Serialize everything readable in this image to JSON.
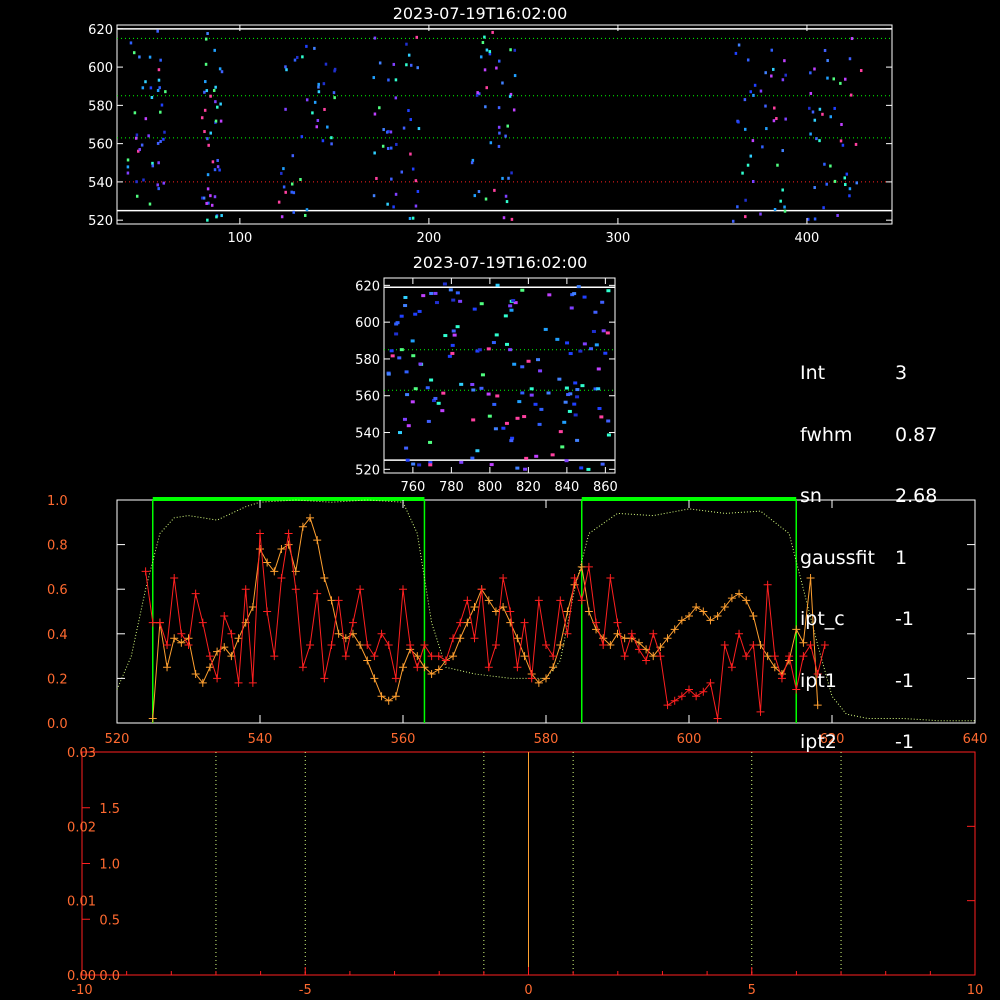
{
  "panels": {
    "top_title": "2023-07-19T16:02:00",
    "mid_title": "2023-07-19T16:02:00"
  },
  "info": [
    {
      "key": "Int",
      "value": "3"
    },
    {
      "key": "fwhm",
      "value": "0.87"
    },
    {
      "key": "sn",
      "value": "2.68"
    },
    {
      "key": "gaussfit",
      "value": "1"
    },
    {
      "key": "ipt_c",
      "value": "-1"
    },
    {
      "key": "ipt1",
      "value": "-1"
    },
    {
      "key": "ipt2",
      "value": "-1"
    }
  ],
  "colors": {
    "background": "#000000",
    "axes": "#ffffff",
    "red": "#ff2020",
    "orange": "#ffa030",
    "green": "#00ff00",
    "yellowgreen": "#d8ff80",
    "tick_orange": "#ff6a30"
  },
  "chart_data": [
    {
      "type": "heatmap",
      "name": "top-spectrogram",
      "title": "2023-07-19T16:02:00",
      "xlim": [
        35,
        445
      ],
      "ylim": [
        518,
        622
      ],
      "x_ticks": [
        100,
        200,
        300,
        400
      ],
      "y_ticks": [
        520,
        540,
        560,
        580,
        600,
        620
      ],
      "hlines": [
        {
          "y": 615,
          "style": "dotted",
          "color": "#00ff00"
        },
        {
          "y": 585,
          "style": "dotted",
          "color": "#00ff00"
        },
        {
          "y": 563,
          "style": "dotted",
          "color": "#00ff00"
        },
        {
          "y": 540,
          "style": "dotted",
          "color": "#ff2020"
        },
        {
          "y": 620,
          "style": "solid",
          "color": "#ffffff"
        },
        {
          "y": 525,
          "style": "solid",
          "color": "#ffffff"
        }
      ],
      "dot_clusters": [
        [
          40,
          60
        ],
        [
          78,
          90
        ],
        [
          120,
          150
        ],
        [
          170,
          195
        ],
        [
          222,
          245
        ],
        [
          360,
          390
        ],
        [
          400,
          430
        ]
      ]
    },
    {
      "type": "heatmap",
      "name": "middle-spectrogram",
      "title": "2023-07-19T16:02:00",
      "xlim": [
        745,
        865
      ],
      "ylim": [
        518,
        624
      ],
      "x_ticks": [
        760,
        780,
        800,
        820,
        840,
        860
      ],
      "y_ticks": [
        520,
        540,
        560,
        580,
        600,
        620
      ],
      "hlines": [
        {
          "y": 585,
          "style": "dotted",
          "color": "#00ff00"
        },
        {
          "y": 563,
          "style": "dotted",
          "color": "#00ff00"
        },
        {
          "y": 619,
          "style": "solid",
          "color": "#ffffff"
        },
        {
          "y": 525,
          "style": "solid",
          "color": "#ffffff"
        }
      ]
    },
    {
      "type": "line",
      "name": "profile-plot",
      "xlim": [
        520,
        640
      ],
      "ylim": [
        0,
        1.0
      ],
      "x_ticks": [
        520,
        540,
        560,
        580,
        600,
        620,
        640
      ],
      "y_ticks": [
        0.0,
        0.2,
        0.4,
        0.6,
        0.8,
        1.0
      ],
      "windows": [
        [
          525,
          563
        ],
        [
          585,
          615
        ]
      ],
      "series": [
        {
          "style": "dotted",
          "color": "#d8ff80",
          "x": [
            520,
            522,
            524,
            526,
            528,
            530,
            532,
            534,
            536,
            538,
            540,
            545,
            550,
            555,
            560,
            562,
            564,
            566,
            570,
            575,
            580,
            582,
            584,
            586,
            590,
            595,
            600,
            605,
            610,
            614,
            616,
            618,
            620,
            622,
            625,
            630,
            635,
            640
          ],
          "y": [
            0.15,
            0.3,
            0.6,
            0.85,
            0.92,
            0.93,
            0.92,
            0.91,
            0.94,
            0.97,
            0.99,
            1.0,
            0.99,
            1.0,
            0.99,
            0.85,
            0.45,
            0.25,
            0.22,
            0.2,
            0.2,
            0.28,
            0.6,
            0.85,
            0.94,
            0.93,
            0.96,
            0.94,
            0.95,
            0.85,
            0.6,
            0.35,
            0.12,
            0.04,
            0.02,
            0.02,
            0.01,
            0.01
          ]
        },
        {
          "style": "solid",
          "color": "#ffa030",
          "marker": "+",
          "x": [
            525,
            526,
            527,
            528,
            529,
            530,
            531,
            532,
            533,
            534,
            535,
            536,
            537,
            538,
            539,
            540,
            541,
            542,
            543,
            544,
            545,
            546,
            547,
            548,
            549,
            550,
            551,
            552,
            553,
            554,
            555,
            556,
            557,
            558,
            559,
            560,
            561,
            562,
            563,
            564,
            565,
            566,
            567,
            568,
            569,
            570,
            571,
            572,
            573,
            574,
            575,
            576,
            577,
            578,
            579,
            580,
            581,
            582,
            583,
            584,
            585,
            586,
            587,
            588,
            589,
            590,
            591,
            592,
            593,
            594,
            595,
            596,
            597,
            598,
            599,
            600,
            601,
            602,
            603,
            604,
            605,
            606,
            607,
            608,
            609,
            610,
            611,
            612,
            613,
            614,
            615,
            616,
            617,
            618
          ],
          "y": [
            0.02,
            0.45,
            0.25,
            0.38,
            0.36,
            0.38,
            0.22,
            0.18,
            0.25,
            0.32,
            0.34,
            0.3,
            0.38,
            0.45,
            0.52,
            0.78,
            0.72,
            0.68,
            0.78,
            0.8,
            0.68,
            0.88,
            0.92,
            0.82,
            0.65,
            0.55,
            0.4,
            0.38,
            0.4,
            0.35,
            0.28,
            0.2,
            0.12,
            0.1,
            0.12,
            0.25,
            0.33,
            0.3,
            0.25,
            0.22,
            0.24,
            0.28,
            0.3,
            0.38,
            0.45,
            0.52,
            0.6,
            0.55,
            0.5,
            0.52,
            0.45,
            0.38,
            0.3,
            0.22,
            0.18,
            0.2,
            0.25,
            0.35,
            0.5,
            0.62,
            0.7,
            0.5,
            0.42,
            0.38,
            0.35,
            0.4,
            0.38,
            0.38,
            0.36,
            0.33,
            0.3,
            0.34,
            0.38,
            0.42,
            0.46,
            0.48,
            0.52,
            0.5,
            0.46,
            0.48,
            0.52,
            0.56,
            0.58,
            0.55,
            0.48,
            0.35,
            0.3,
            0.25,
            0.22,
            0.28,
            0.42,
            0.36,
            0.65,
            0.08
          ]
        },
        {
          "style": "solid",
          "color": "#ff2020",
          "marker": "+",
          "x": [
            524,
            525,
            526,
            527,
            528,
            529,
            530,
            531,
            532,
            533,
            534,
            535,
            536,
            537,
            538,
            539,
            540,
            541,
            542,
            543,
            544,
            545,
            546,
            547,
            548,
            549,
            550,
            551,
            552,
            553,
            554,
            555,
            556,
            557,
            558,
            559,
            560,
            561,
            562,
            563,
            564,
            565,
            566,
            567,
            568,
            569,
            570,
            571,
            572,
            573,
            574,
            575,
            576,
            577,
            578,
            579,
            580,
            581,
            582,
            583,
            584,
            585,
            586,
            587,
            588,
            589,
            590,
            591,
            592,
            593,
            594,
            595,
            596,
            597,
            598,
            599,
            600,
            601,
            602,
            603,
            604,
            605,
            606,
            607,
            608,
            609,
            610,
            611,
            612,
            613,
            614,
            615,
            616,
            617,
            618,
            619
          ],
          "y": [
            0.68,
            0.45,
            0.45,
            0.35,
            0.65,
            0.4,
            0.35,
            0.58,
            0.45,
            0.3,
            0.2,
            0.48,
            0.4,
            0.18,
            0.6,
            0.18,
            0.85,
            0.5,
            0.3,
            0.65,
            0.85,
            0.6,
            0.25,
            0.35,
            0.58,
            0.2,
            0.35,
            0.55,
            0.3,
            0.45,
            0.6,
            0.35,
            0.3,
            0.4,
            0.35,
            0.2,
            0.6,
            0.35,
            0.25,
            0.35,
            0.3,
            0.3,
            0.28,
            0.38,
            0.45,
            0.55,
            0.38,
            0.6,
            0.25,
            0.35,
            0.65,
            0.5,
            0.25,
            0.45,
            0.2,
            0.55,
            0.35,
            0.3,
            0.55,
            0.4,
            0.65,
            0.55,
            0.7,
            0.45,
            0.35,
            0.65,
            0.45,
            0.3,
            0.4,
            0.33,
            0.28,
            0.4,
            0.3,
            0.08,
            0.1,
            0.12,
            0.15,
            0.12,
            0.14,
            0.18,
            0.02,
            0.35,
            0.25,
            0.4,
            0.3,
            0.35,
            0.05,
            0.62,
            0.3,
            0.2,
            0.3,
            0.15,
            0.3,
            0.35,
            0.22,
            0.35
          ]
        }
      ]
    },
    {
      "type": "line",
      "name": "offset-plot",
      "xlim": [
        -10,
        10
      ],
      "x_ticks": [
        -10,
        -5,
        0,
        5,
        10
      ],
      "y_ticks_inner": [
        0.0,
        0.5,
        1.0,
        1.5
      ],
      "y_ticks_outer": [
        0.0,
        0.01,
        0.02,
        0.03
      ],
      "vlines": [
        {
          "x": -7,
          "style": "dotted",
          "color": "#d8ff80"
        },
        {
          "x": -5,
          "style": "dotted",
          "color": "#d8ff80"
        },
        {
          "x": -1,
          "style": "dotted",
          "color": "#d8ff80"
        },
        {
          "x": 0,
          "style": "solid",
          "color": "#ffa030"
        },
        {
          "x": 1,
          "style": "dotted",
          "color": "#d8ff80"
        },
        {
          "x": 5,
          "style": "dotted",
          "color": "#d8ff80"
        },
        {
          "x": 7,
          "style": "dotted",
          "color": "#d8ff80"
        }
      ]
    }
  ]
}
